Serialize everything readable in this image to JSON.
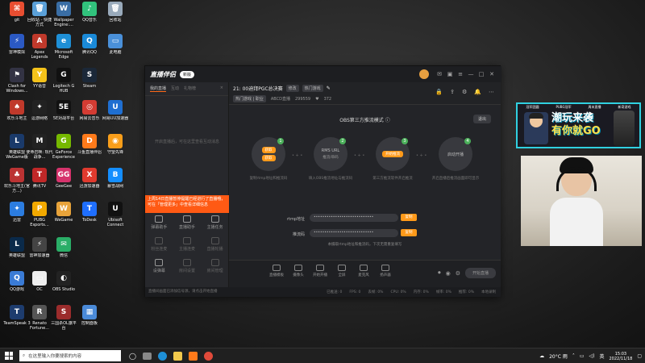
{
  "desktop": {
    "icons": [
      {
        "label": "git",
        "color": "#e84e31",
        "glyph": "⌘"
      },
      {
        "label": "回收站 - 快捷方式",
        "color": "#5aa0d8",
        "glyph": "🗑"
      },
      {
        "label": "Wallpaper Engine:...",
        "color": "#3a6ea5",
        "glyph": "W"
      },
      {
        "label": "QQ音乐",
        "color": "#31c27c",
        "glyph": "♪"
      },
      {
        "label": "回收站",
        "color": "#9ab",
        "glyph": "🗑"
      },
      {
        "label": "雷神模拟",
        "color": "#2b59c3",
        "glyph": "⚡"
      },
      {
        "label": "Apex Legends",
        "color": "#c0392b",
        "glyph": "A"
      },
      {
        "label": "Microsoft Edge",
        "color": "#1e8fd6",
        "glyph": "e"
      },
      {
        "label": "腾讯QQ",
        "color": "#1a8ad8",
        "glyph": "Q"
      },
      {
        "label": "此电脑",
        "color": "#4a90d9",
        "glyph": "▭"
      },
      {
        "label": "Clash for Windows...",
        "color": "#334",
        "glyph": "⚑"
      },
      {
        "label": "YY语音",
        "color": "#f4c21a",
        "glyph": "Y"
      },
      {
        "label": "Logitech G HUB",
        "color": "#111",
        "glyph": "G"
      },
      {
        "label": "Steam",
        "color": "#1b2838",
        "glyph": "S"
      },
      {
        "label": "欢乐斗地主",
        "color": "#c0392b",
        "glyph": "♠"
      },
      {
        "label": "逗游网络",
        "color": "#222",
        "glyph": "✦"
      },
      {
        "label": "5E对战平台",
        "color": "#111",
        "glyph": "5E"
      },
      {
        "label": "网易云音乐",
        "color": "#d43c33",
        "glyph": "◎"
      },
      {
        "label": "网易UU加速器",
        "color": "#1f6fd1",
        "glyph": "U"
      },
      {
        "label": "英雄联盟 WeGame版",
        "color": "#1a3a6a",
        "glyph": "L"
      },
      {
        "label": "使命召唤: 现代战争...",
        "color": "#222",
        "glyph": "M"
      },
      {
        "label": "GeForce Experience",
        "color": "#76b900",
        "glyph": "G"
      },
      {
        "label": "斗鱼直播伴侣",
        "color": "#ff7a1a",
        "glyph": "D"
      },
      {
        "label": "守望先锋",
        "color": "#f99e1a",
        "glyph": "◉"
      },
      {
        "label": "欢乐斗地主(官方...)",
        "color": "#b33",
        "glyph": "♣"
      },
      {
        "label": "腾讯TV",
        "color": "#c02828",
        "glyph": "T"
      },
      {
        "label": "GeeGee",
        "color": "#d6336c",
        "glyph": "GG"
      },
      {
        "label": "迅游加速器",
        "color": "#e03a2e",
        "glyph": "X"
      },
      {
        "label": "暴雪战网",
        "color": "#148eff",
        "glyph": "B"
      },
      {
        "label": "迅雷",
        "color": "#2c7de0",
        "glyph": "✦"
      },
      {
        "label": "PUBG Esports...",
        "color": "#f2a900",
        "glyph": "P"
      },
      {
        "label": "WeGame",
        "color": "#e8a33a",
        "glyph": "W"
      },
      {
        "label": "ToDesk",
        "color": "#1f6fff",
        "glyph": "T"
      },
      {
        "label": "Ubisoft Connect",
        "color": "#111",
        "glyph": "U"
      },
      {
        "label": "英雄联盟",
        "color": "#0a2a4a",
        "glyph": "L"
      },
      {
        "label": "雷神加速器",
        "color": "#444",
        "glyph": "⚡"
      },
      {
        "label": "微信",
        "color": "#2aae67",
        "glyph": "✉"
      },
      {
        "label": "QQ游戏",
        "color": "#3a7bd5",
        "glyph": "Q"
      },
      {
        "label": "OC",
        "color": "#eee",
        "glyph": "▭"
      },
      {
        "label": "OBS Studio",
        "color": "#222",
        "glyph": "◐"
      },
      {
        "label": "TeamSpeak 3",
        "color": "#1d3c6e",
        "glyph": "T"
      },
      {
        "label": "Renato Fortune...",
        "color": "#555",
        "glyph": "R"
      },
      {
        "label": "三国杀OL旗平台",
        "color": "#9b2c2c",
        "glyph": "S"
      },
      {
        "label": "控制面板",
        "color": "#4a8ad8",
        "glyph": "▦"
      }
    ]
  },
  "app": {
    "logo": "直播伴侣",
    "version_badge": "新版",
    "sidebar_tabs": [
      "我的直播",
      "互动",
      "礼物榜"
    ],
    "sidebar_close": "×",
    "sidebar_empty": "开启直播后，可在这里查看互动消息",
    "notice_text": "上周14日直播暂停提醒已经进行了直播哦，可在「管理更多」中查看详细信息",
    "tools": [
      {
        "label": "弹幕助手",
        "dim": false
      },
      {
        "label": "直播助手",
        "dim": false
      },
      {
        "label": "主播任务",
        "dim": false
      },
      {
        "label": "粉丝连麦",
        "dim": true
      },
      {
        "label": "主播连麦",
        "dim": true
      },
      {
        "label": "直播轮播",
        "dim": true
      },
      {
        "label": "设弹幕",
        "dim": false
      },
      {
        "label": "房间设置",
        "dim": true
      },
      {
        "label": "房间管理",
        "dim": true
      }
    ],
    "room": {
      "title": "21: 00迪拜PGC总决赛",
      "edit_chip": "修改",
      "category_chip": "热门游戏",
      "tag_chip": "热门游戏 | 职业",
      "room_label": "ABCD直播",
      "room_number": "299559",
      "fans": "372"
    },
    "obs": {
      "title": "OBS第三方推流模式",
      "exit_label": "退出",
      "steps": [
        {
          "num": "1",
          "pill_a": "获取",
          "pill_b": "获取",
          "desc": "复制rtmp地址和推流码"
        },
        {
          "num": "2",
          "title": "RMS URL",
          "subtitle": "推流/串码",
          "desc": "填入OBS推流地址与推流码"
        },
        {
          "num": "3",
          "pill_a": "开始推流",
          "desc": "第三方推流软件开启推流"
        },
        {
          "num": "4",
          "title": "启动开播",
          "desc": "开启直播后推流画面即可显示"
        }
      ],
      "rtmp_label": "rtmp地址",
      "rtmp_value": "••••••••••••••••••••••••••••",
      "key_label": "推流码",
      "key_value": "••••••••••••••••••••••••••••",
      "copy_label": "复制",
      "hint": "本摄取rtmp地址和推流码，下次无需重复填写"
    },
    "toolbar": {
      "items": [
        "直播模板",
        "摄像头",
        "开始开播",
        "全屏",
        "麦克风",
        "扬声器"
      ],
      "start_live": "开始直播"
    },
    "status": {
      "left": "直播间画面已添加信号源，请点击开始直播",
      "items": [
        "已推送: 0",
        "FPS: 0",
        "丢帧: 0%",
        "CPU: 0%",
        "内存: 0%",
        "帧率: 0%",
        "推荐: 0%",
        "本地录制"
      ]
    }
  },
  "overlay": {
    "banner_top": [
      "冠军团圆",
      "PUBG冠军",
      "周末直播",
      "新奇游戏"
    ],
    "banner_line1": "潮玩来袭",
    "banner_line2": "有你就GO"
  },
  "taskbar": {
    "search_placeholder": "在这里输入你要搜索的内容",
    "weather": "20°C 雨",
    "lang": "英",
    "time": "15:03",
    "date": "2022/11/18"
  }
}
